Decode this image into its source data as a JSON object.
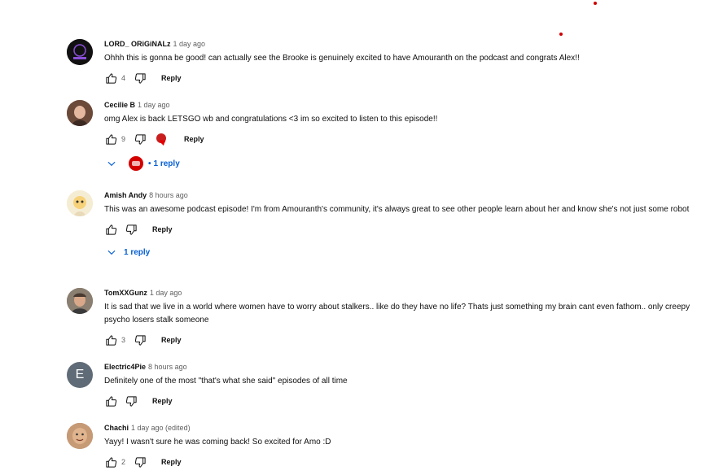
{
  "colors": {
    "link": "#065fd4",
    "text": "#0f0f0f",
    "muted": "#606060",
    "accent_dot": "#cc0000"
  },
  "comments": [
    {
      "author": "LORD_ ORiGiNALz",
      "time": "1 day ago",
      "text": "Ohhh this is gonna be good! can actually see the Brooke is genuinely excited to have Amouranth on the podcast and congrats Alex!!",
      "likes": "4",
      "reply_label": "Reply"
    },
    {
      "author": "Cecilie B",
      "time": "1 day ago",
      "text": "omg Alex is back LETSGO wb and congratulations <3 im so excited to listen to this episode!!",
      "likes": "9",
      "reply_label": "Reply",
      "replies_label": "1 reply"
    },
    {
      "author": "Amish Andy",
      "time": "8 hours ago",
      "text": "This was an awesome podcast episode! I'm from Amouranth's community, it's always great to see other people learn about her and know she's not just some robot",
      "likes": "",
      "reply_label": "Reply",
      "replies_label": "1 reply"
    },
    {
      "author": "TomXXGunz",
      "time": "1 day ago",
      "text": "It is sad that we live in a world where women have to worry about stalkers.. like do they have no life? Thats just something my brain cant even fathom.. only creepy psycho losers stalk someone",
      "likes": "3",
      "reply_label": "Reply"
    },
    {
      "author": "Electric4Pie",
      "time": "8 hours ago",
      "avatar_letter": "E",
      "text": "Definitely one of the most \"that's what she said\" episodes of all time",
      "likes": "",
      "reply_label": "Reply"
    },
    {
      "author": "Chachi",
      "time": "1 day ago (edited)",
      "text": "Yayy! I wasn't sure he was coming back! So excited for Amo :D",
      "likes": "2",
      "reply_label": "Reply"
    }
  ]
}
